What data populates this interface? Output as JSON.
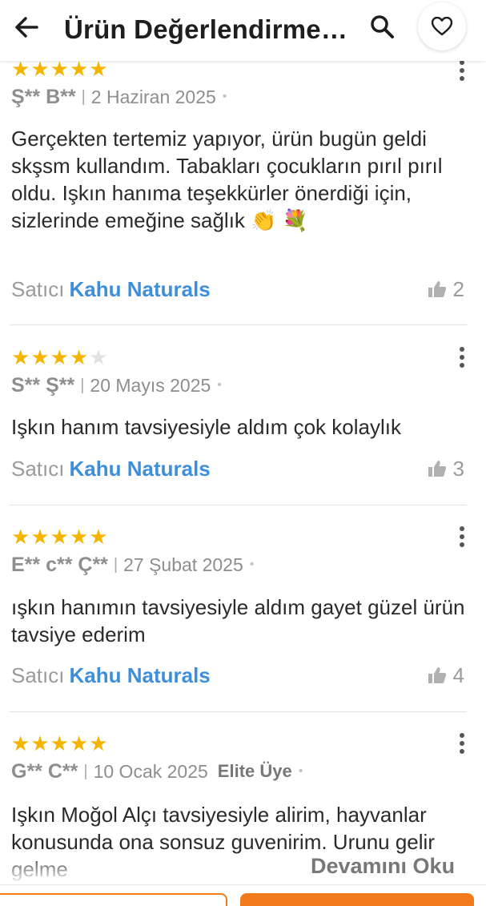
{
  "header": {
    "title": "Ürün Değerlendirmeleri"
  },
  "reviews": [
    {
      "rating": 5,
      "author": "Ş** B**",
      "date": "2 Haziran 2025",
      "badge": "",
      "text": "Gerçekten tertemiz yapıyor, ürün bugün geldi skşsm kullandım. Tabakları çocukların pırıl pırıl oldu. Işkın hanıma teşekkürler önerdiği için, sizlerinde emeğine sağlık 👏 💐",
      "seller_label": "Satıcı",
      "seller_name": "Kahu Naturals",
      "likes": "2"
    },
    {
      "rating": 4,
      "author": "S** Ş**",
      "date": "20 Mayıs 2025",
      "badge": "",
      "text": "Işkın hanım tavsiyesiyle aldım çok kolaylık",
      "seller_label": "Satıcı",
      "seller_name": "Kahu Naturals",
      "likes": "3"
    },
    {
      "rating": 5,
      "author": "E** c** Ç**",
      "date": "27 Şubat 2025",
      "badge": "",
      "text": "ışkın hanımın tavsiyesiyle aldım gayet güzel ürün tavsiye ederim",
      "seller_label": "Satıcı",
      "seller_name": "Kahu Naturals",
      "likes": "4"
    },
    {
      "rating": 5,
      "author": "G** C**",
      "date": "10 Ocak 2025",
      "badge": "Elite Üye",
      "text": "Işkın Moğol Alçı tavsiyesiyle alirim, hayvanlar konusunda ona sonsuz guvenirim. Urunu gelir gelme",
      "read_more": "Devamını Oku"
    }
  ],
  "colors": {
    "star": "#f5b400",
    "seller_link": "#3d8fdc",
    "accent": "#f27a1a"
  },
  "icons": [
    "back-arrow-icon",
    "search-icon",
    "heart-icon",
    "more-vertical-icon",
    "thumbs-up-icon",
    "star-icon"
  ]
}
